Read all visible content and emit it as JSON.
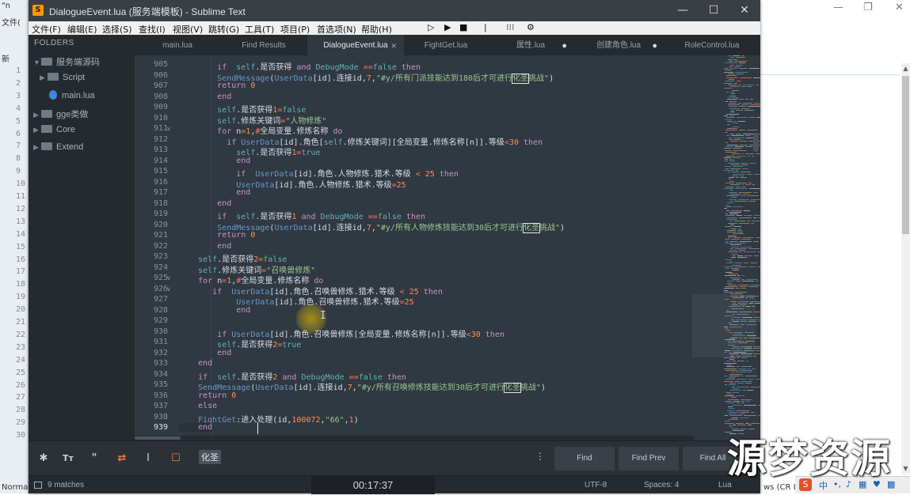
{
  "background": {
    "left_panel": {
      "items": [
        "\"n",
        "文件(",
        "新",
        "1",
        "2",
        "3",
        "4",
        "5",
        "6",
        "7",
        "8",
        "9",
        "10",
        "11",
        "12",
        "13",
        "14",
        "15",
        "16",
        "17",
        "18",
        "19",
        "20",
        "21",
        "22",
        "23",
        "24",
        "25",
        "26",
        "27",
        "28",
        "29",
        "30",
        "Norma"
      ]
    },
    "status_right": "ws (CR LF)",
    "watermark": "源梦资源"
  },
  "window": {
    "title": "DialogueEvent.lua (服务端模板) - Sublime Text",
    "logo": "S",
    "controls": {
      "minimize": "—",
      "maximize": "☐",
      "close": "✕"
    }
  },
  "menu": [
    "文件(F)",
    "编辑(E)",
    "选择(S)",
    "查找(I)",
    "视图(V)",
    "跳转(G)",
    "工具(T)",
    "项目(P)",
    "首选项(N)",
    "帮助(H)"
  ],
  "toolbar": {
    "play": "▷",
    "run": "▶",
    "stop": "■",
    "sep": "|",
    "dots": "⁝⁝⁝",
    "gear": "⚙"
  },
  "sidebar": {
    "header": "FOLDERS",
    "items": [
      {
        "label": "服务端源码",
        "type": "folder",
        "expanded": true
      },
      {
        "label": "Script",
        "type": "folder",
        "expanded": false
      },
      {
        "label": "main.lua",
        "type": "file"
      },
      {
        "label": "gge类做",
        "type": "folder",
        "expanded": false
      },
      {
        "label": "Core",
        "type": "folder",
        "expanded": false
      },
      {
        "label": "Extend",
        "type": "folder",
        "expanded": false
      }
    ]
  },
  "tabs": [
    {
      "label": "main.lua",
      "active": false,
      "dirty": false
    },
    {
      "label": "Find Results",
      "active": false,
      "dirty": false
    },
    {
      "label": "DialogueEvent.lua",
      "active": true,
      "dirty": false
    },
    {
      "label": "FightGet.lua",
      "active": false,
      "dirty": false
    },
    {
      "label": "属性.lua",
      "active": false,
      "dirty": true
    },
    {
      "label": "创建角色.lua",
      "active": false,
      "dirty": true
    },
    {
      "label": "RoleControl.lua",
      "active": false,
      "dirty": false
    }
  ],
  "editor": {
    "current_line": "939",
    "lines": [
      {
        "n": "905",
        "code": "        if  self.是否获得 and DebugMode ==false then"
      },
      {
        "n": "906",
        "code": "        SendMessage(UserData[id].连接id,7,\"#y/所有门派技能达到180后才可进行化圣挑战\")"
      },
      {
        "n": "907",
        "code": "        return 0"
      },
      {
        "n": "908",
        "code": "        end"
      },
      {
        "n": "909",
        "code": "        self.是否获得1=false"
      },
      {
        "n": "910",
        "code": "        self.修炼关键词=\"人物修炼\""
      },
      {
        "n": "911",
        "code": "        for n=1,#全局变量.修炼名称 do"
      },
      {
        "n": "912",
        "code": "          if UserData[id].角色[self.修炼关键词][全局变量.修炼名称[n]].等级<30 then"
      },
      {
        "n": "913",
        "code": "            self.是否获得1=true"
      },
      {
        "n": "914",
        "code": "            end"
      },
      {
        "n": "915",
        "code": "            if  UserData[id].角色.人物修炼.猎术.等级 < 25 then"
      },
      {
        "n": "916",
        "code": "            UserData[id].角色.人物修炼.猎术.等级=25"
      },
      {
        "n": "917",
        "code": "            end"
      },
      {
        "n": "918",
        "code": "        end"
      },
      {
        "n": "919",
        "code": "        if  self.是否获得1 and DebugMode ==false then"
      },
      {
        "n": "920",
        "code": "        SendMessage(UserData[id].连接id,7,\"#y/所有人物修炼技能达到30后才可进行化圣挑战\")"
      },
      {
        "n": "921",
        "code": "        return 0"
      },
      {
        "n": "922",
        "code": "        end"
      },
      {
        "n": "923",
        "code": "    self.是否获得2=false"
      },
      {
        "n": "924",
        "code": "    self.修炼关键词=\"召唤兽修炼\""
      },
      {
        "n": "925",
        "code": "    for n=1,#全局变量.修炼名称 do"
      },
      {
        "n": "926",
        "code": "       if  UserData[id].角色.召唤兽修炼.猎术.等级 < 25 then"
      },
      {
        "n": "927",
        "code": "            UserData[id].角色.召唤兽修炼.猎术.等级=25"
      },
      {
        "n": "928",
        "code": "            end"
      },
      {
        "n": "929",
        "code": ""
      },
      {
        "n": "930",
        "code": "        if UserData[id].角色.召唤兽修炼[全局变量.修炼名称[n]].等级<30 then"
      },
      {
        "n": "931",
        "code": "        self.是否获得2=true"
      },
      {
        "n": "932",
        "code": "        end"
      },
      {
        "n": "933",
        "code": "    end"
      },
      {
        "n": "934",
        "code": "    if  self.是否获得2 and DebugMode ==false then"
      },
      {
        "n": "935",
        "code": "    SendMessage(UserData[id].连接id,7,\"#y/所有召唤修炼技能达到30后才可进行化圣挑战\")"
      },
      {
        "n": "936",
        "code": "    return 0"
      },
      {
        "n": "937",
        "code": "    else"
      },
      {
        "n": "938",
        "code": "    FightGet:进入处理(id,100072,\"66\",1)"
      },
      {
        "n": "939",
        "code": "    end"
      }
    ]
  },
  "findbar": {
    "options": [
      "✱",
      "Tт",
      "\"",
      "⇄",
      "I",
      "☐"
    ],
    "query": "化圣",
    "more": "⋮",
    "buttons": [
      "Find",
      "Find Prev",
      "Find All"
    ]
  },
  "status": {
    "matches": "9 matches",
    "video_time": "00:17:37",
    "encoding": "UTF-8",
    "spaces": "Spaces: 4",
    "syntax": "Lua"
  },
  "colors": {
    "editor_bg": "#303841",
    "sidebar_bg": "#252a2f",
    "keyword": "#c695c6",
    "builtin": "#5fb4b4",
    "string": "#99c794",
    "number": "#f99157",
    "operator": "#f97b58",
    "function": "#6699cc",
    "findbar_active": "#f97a3d"
  }
}
